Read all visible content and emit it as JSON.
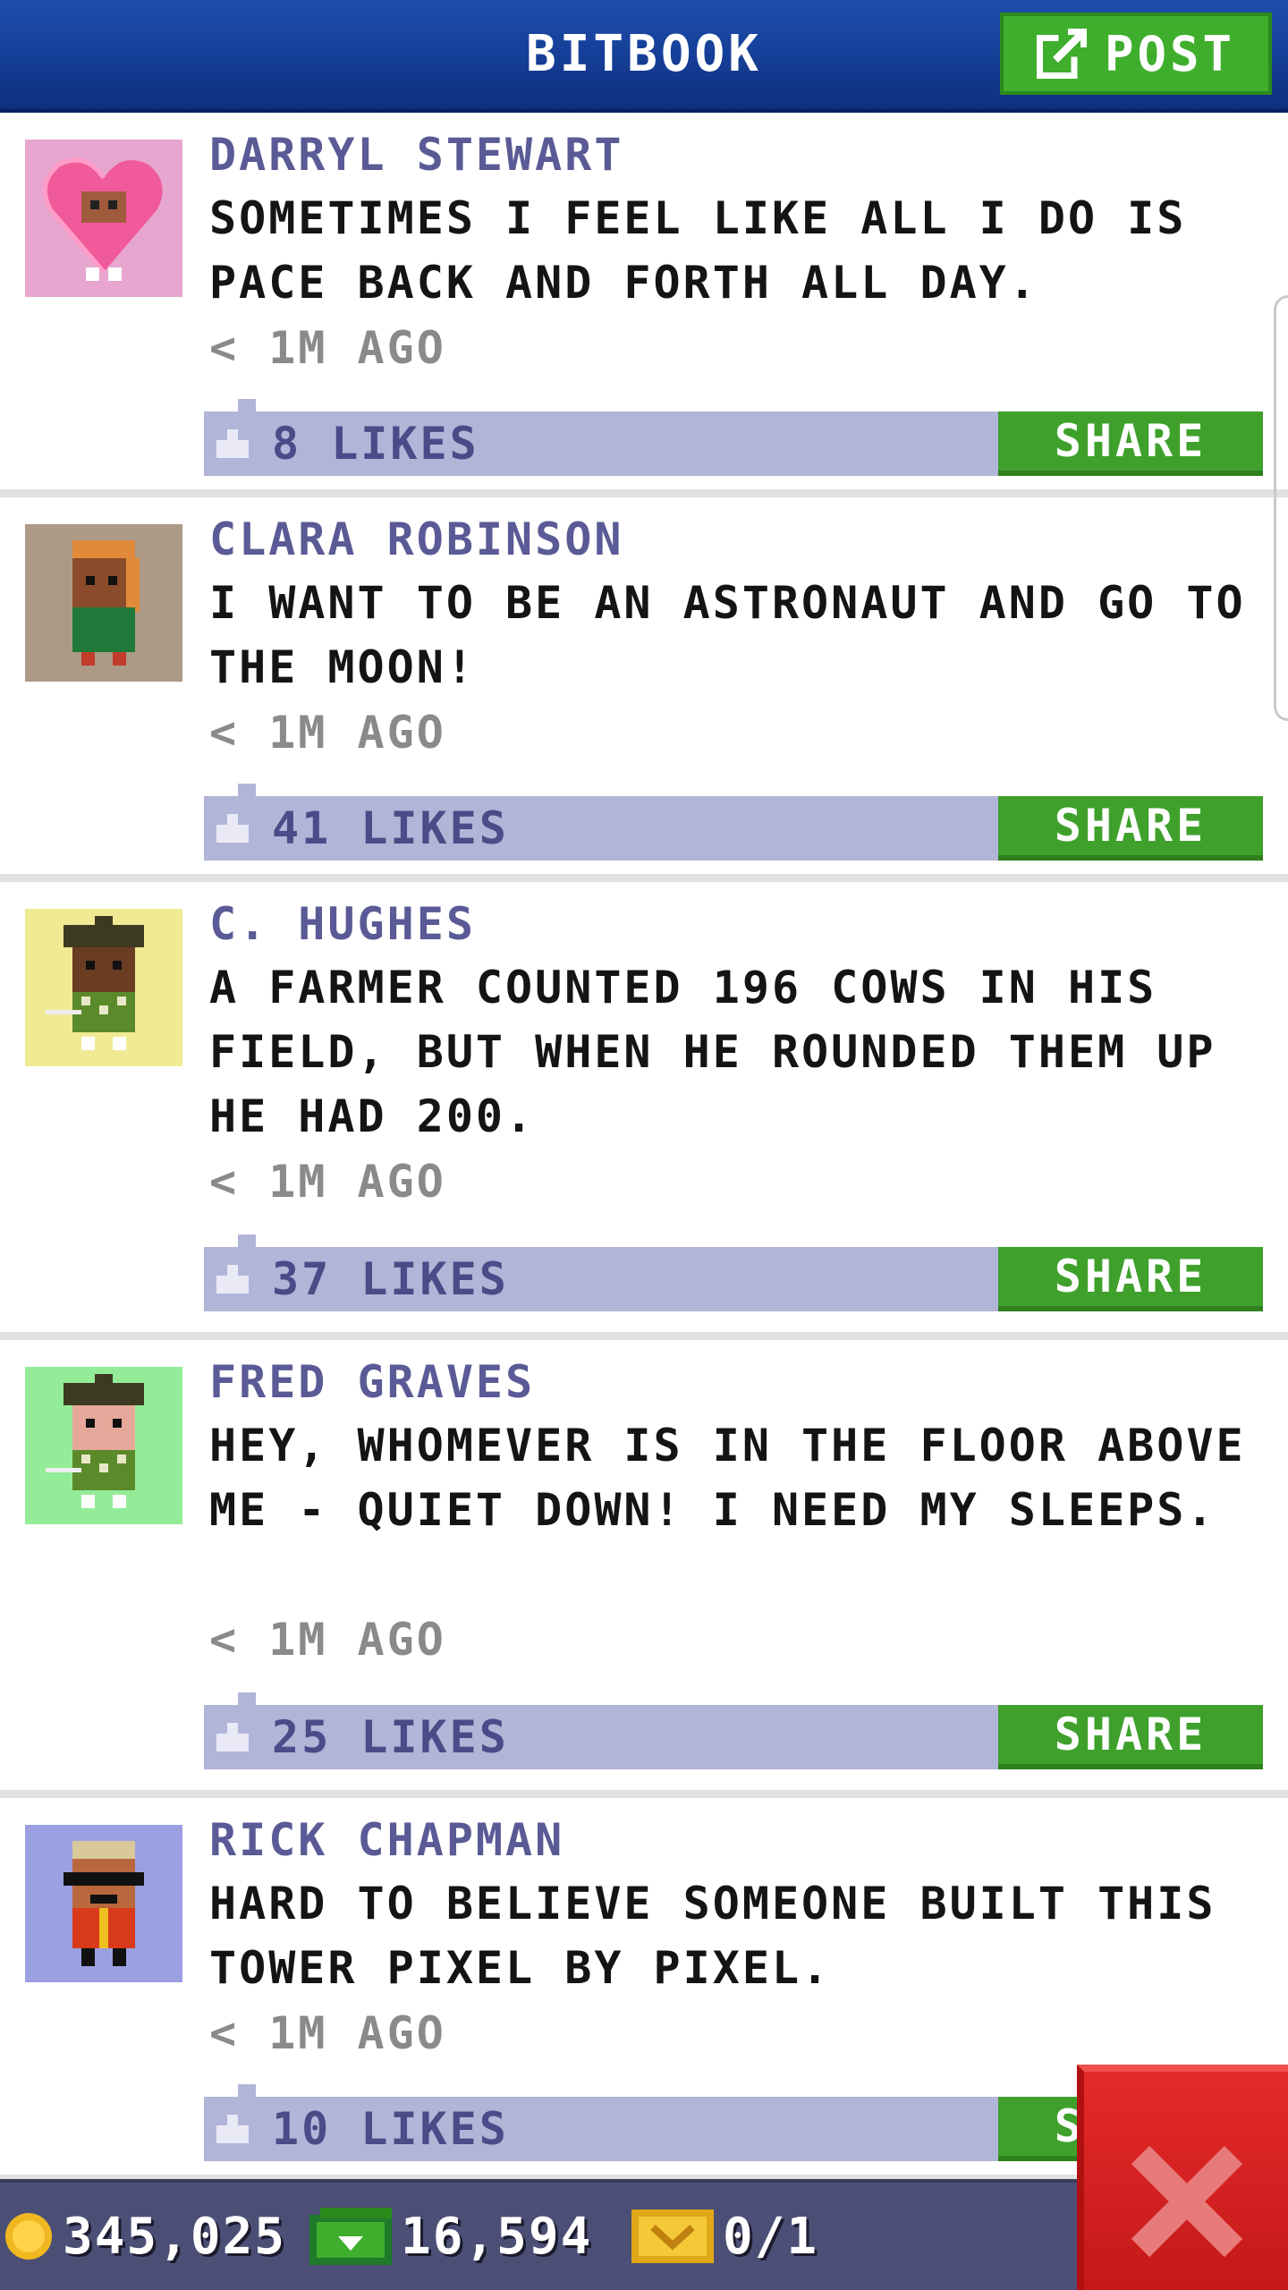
{
  "header": {
    "title": "BITBOOK",
    "post_label": "POST"
  },
  "posts": [
    {
      "author": "DARRYL STEWART",
      "message": "SOMETIMES I FEEL LIKE ALL I DO IS PACE BACK AND FORTH ALL DAY.",
      "time": "< 1M AGO",
      "likes": "8 LIKES",
      "share_label": "SHARE",
      "avatar_bg": "#e7a6cf",
      "avatar_icon": "heart-costume-avatar-icon"
    },
    {
      "author": "CLARA ROBINSON",
      "message": "I WANT TO BE AN ASTRONAUT AND GO TO THE MOON!",
      "time": "< 1M AGO",
      "likes": "41 LIKES",
      "share_label": "SHARE",
      "avatar_bg": "#ad9a86",
      "avatar_icon": "person-avatar-icon"
    },
    {
      "author": "C. HUGHES",
      "message": "A FARMER COUNTED 196 COWS IN HIS FIELD, BUT WHEN HE ROUNDED THEM UP HE HAD 200.",
      "time": "< 1M AGO",
      "likes": "37 LIKES",
      "share_label": "SHARE",
      "avatar_bg": "#f0ea94",
      "avatar_icon": "golfer-avatar-icon"
    },
    {
      "author": "FRED GRAVES",
      "message": "HEY, WHOMEVER IS IN THE FLOOR ABOVE ME - QUIET DOWN! I NEED MY SLEEPS.",
      "time": "< 1M AGO",
      "likes": "25 LIKES",
      "share_label": "SHARE",
      "avatar_bg": "#94ec98",
      "avatar_icon": "golfer-avatar-icon"
    },
    {
      "author": "RICK CHAPMAN",
      "message": "HARD TO BELIEVE SOMEONE BUILT THIS TOWER PIXEL BY PIXEL.",
      "time": "< 1M AGO",
      "likes": "10 LIKES",
      "share_label": "SHARE",
      "avatar_bg": "#9ba0e2",
      "avatar_icon": "sunglasses-avatar-icon"
    }
  ],
  "status": {
    "coins": "345,025",
    "bux": "16,594",
    "tickets": "0/1"
  },
  "colors": {
    "header": "#1d4fae",
    "accent_green": "#3fae2c",
    "likes_bar": "#b1b5d8",
    "close_red": "#d82020"
  }
}
